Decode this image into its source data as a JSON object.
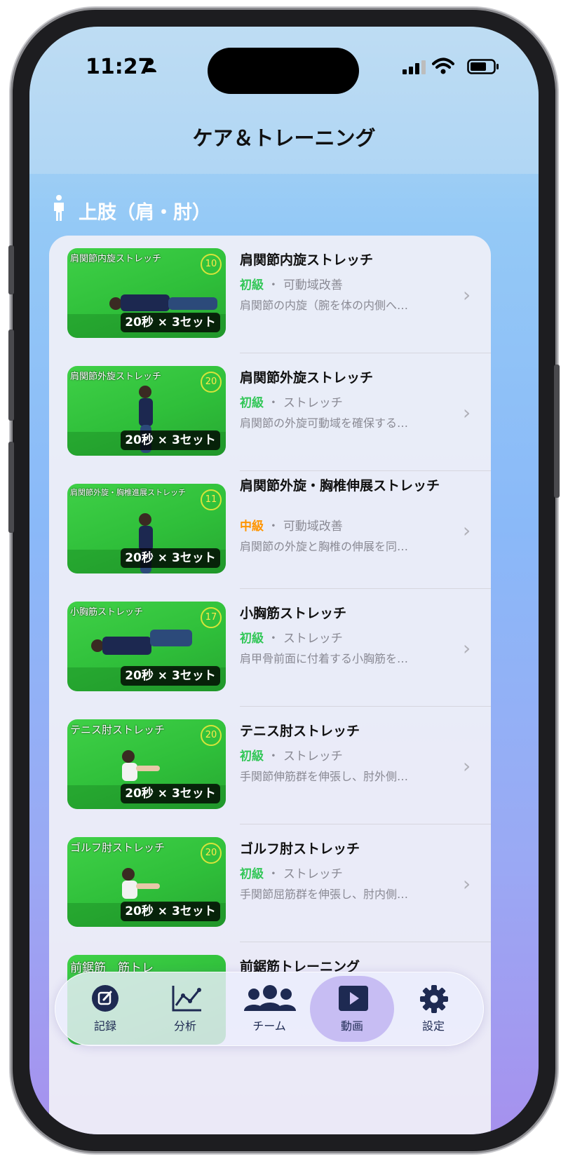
{
  "status_bar": {
    "time": "11:27"
  },
  "header": {
    "title": "ケア＆トレーニング"
  },
  "section": {
    "title": "上肢（肩・肘）"
  },
  "exercises": [
    {
      "thumb_caption": "肩関節内旋ストレッチ",
      "timer": "10",
      "badge": "20秒 × 3セット",
      "title": "肩関節内旋ストレッチ",
      "level": "初級",
      "separator": "・",
      "category": "可動域改善",
      "description": "肩関節の内旋（腕を体の内側へ…",
      "level_color": "#34c759"
    },
    {
      "thumb_caption": "肩関節外旋ストレッチ",
      "timer": "20",
      "badge": "20秒 × 3セット",
      "title": "肩関節外旋ストレッチ",
      "level": "初級",
      "separator": "・",
      "category": "ストレッチ",
      "description": "肩関節の外旋可動域を確保する…",
      "level_color": "#34c759"
    },
    {
      "thumb_caption": "肩関節外旋・胸椎進展ストレッチ",
      "timer": "11",
      "badge": "20秒 × 3セット",
      "title": "肩関節外旋・胸椎伸展ストレッチ",
      "level": "中級",
      "separator": "・",
      "category": "可動域改善",
      "description": "肩関節の外旋と胸椎の伸展を同…",
      "level_color": "#ff9500"
    },
    {
      "thumb_caption": "小胸筋ストレッチ",
      "timer": "17",
      "badge": "20秒 × 3セット",
      "title": "小胸筋ストレッチ",
      "level": "初級",
      "separator": "・",
      "category": "ストレッチ",
      "description": "肩甲骨前面に付着する小胸筋を…",
      "level_color": "#34c759"
    },
    {
      "thumb_caption": "テニス肘ストレッチ",
      "timer": "20",
      "badge": "20秒 × 3セット",
      "title": "テニス肘ストレッチ",
      "level": "初級",
      "separator": "・",
      "category": "ストレッチ",
      "description": "手関節伸筋群を伸張し、肘外側…",
      "level_color": "#34c759"
    },
    {
      "thumb_caption": "ゴルフ肘ストレッチ",
      "timer": "20",
      "badge": "20秒 × 3セット",
      "title": "ゴルフ肘ストレッチ",
      "level": "初級",
      "separator": "・",
      "category": "ストレッチ",
      "description": "手関節屈筋群を伸張し、肘内側…",
      "level_color": "#34c759"
    },
    {
      "thumb_caption": "前鋸筋　筋トレ",
      "timer": "",
      "badge": "",
      "title": "前鋸筋トレーニング",
      "level": "",
      "separator": "",
      "category": "",
      "description": "",
      "level_color": "#34c759"
    }
  ],
  "tabbar": {
    "items": [
      {
        "label": "記録",
        "icon": "pencil-square-icon"
      },
      {
        "label": "分析",
        "icon": "line-chart-icon"
      },
      {
        "label": "チーム",
        "icon": "people-icon"
      },
      {
        "label": "動画",
        "icon": "play-icon"
      },
      {
        "label": "設定",
        "icon": "gear-icon"
      }
    ],
    "active_index": 3
  },
  "colors": {
    "beginner": "#34c759",
    "intermediate": "#ff9500",
    "accent": "#1e2a52"
  }
}
